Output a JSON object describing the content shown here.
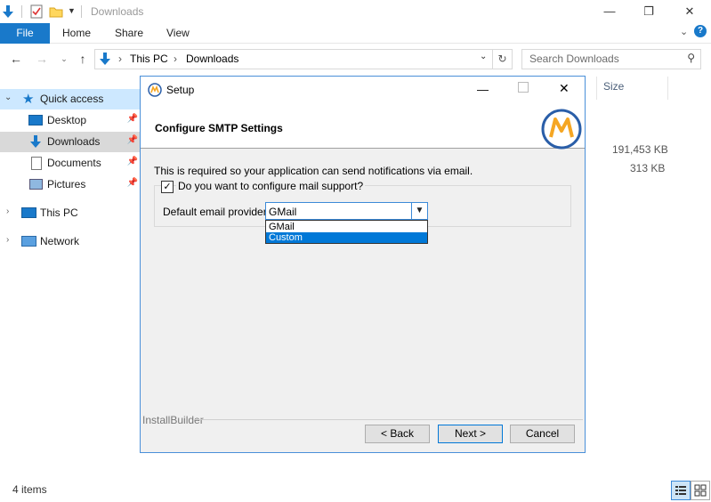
{
  "window": {
    "title": "Downloads"
  },
  "ribbon": {
    "tabs": [
      "File",
      "Home",
      "Share",
      "View"
    ]
  },
  "address": {
    "path": [
      "This PC",
      "Downloads"
    ]
  },
  "search": {
    "placeholder": "Search Downloads"
  },
  "sidebar": {
    "items": [
      {
        "label": "Quick access",
        "icon": "star-icon"
      },
      {
        "label": "Desktop",
        "icon": "desktop-icon",
        "pinned": true
      },
      {
        "label": "Downloads",
        "icon": "download-icon",
        "pinned": true
      },
      {
        "label": "Documents",
        "icon": "document-icon",
        "pinned": true
      },
      {
        "label": "Pictures",
        "icon": "pictures-icon",
        "pinned": true
      },
      {
        "label": "This PC",
        "icon": "computer-icon"
      },
      {
        "label": "Network",
        "icon": "network-icon"
      }
    ]
  },
  "filelist": {
    "size_header": "Size",
    "sizes": [
      "191,453 KB",
      "313 KB"
    ]
  },
  "status": {
    "items": "4 items"
  },
  "dialog": {
    "title": "Setup",
    "heading": "Configure SMTP Settings",
    "description": "This is required so your application can send notifications via email.",
    "checkbox_label": "Do you want to configure mail support?",
    "checkbox_checked": true,
    "provider_label": "Default email provider:",
    "provider_value": "GMail",
    "options": [
      "GMail",
      "Custom"
    ],
    "footer_brand": "InstallBuilder",
    "buttons": {
      "back": "< Back",
      "next": "Next >",
      "cancel": "Cancel"
    }
  },
  "colors": {
    "accent": "#1979ca",
    "selection": "#0078d7",
    "logo_blue": "#2a5ea8",
    "logo_orange": "#f5a623"
  }
}
